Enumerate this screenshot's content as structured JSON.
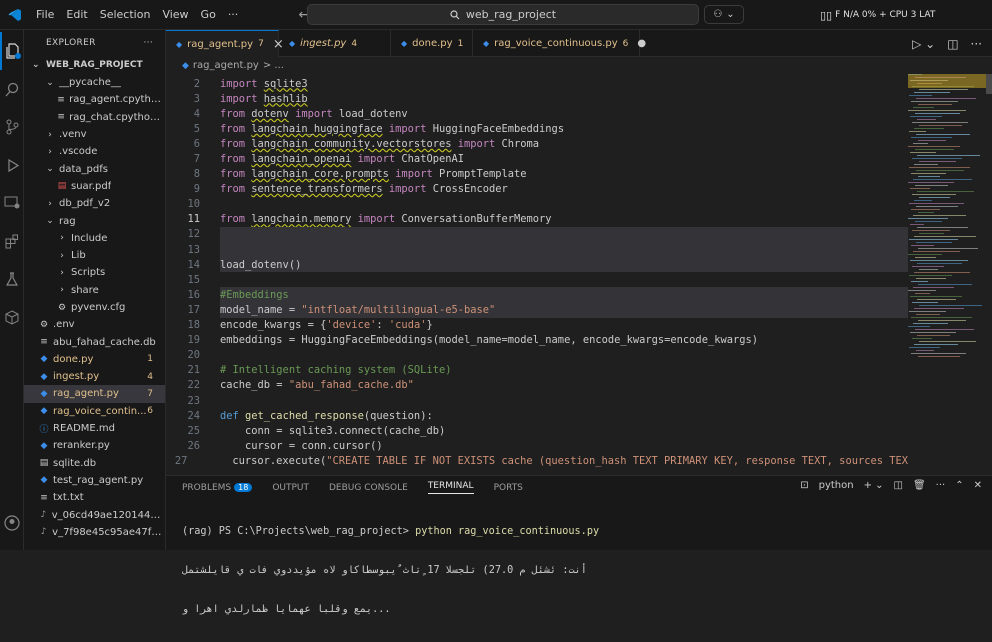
{
  "titlebar": {
    "menu": [
      "File",
      "Edit",
      "Selection",
      "View",
      "Go",
      "···"
    ],
    "search_text": "web_rag_project",
    "status_text": "F N/A 0% + CPU 3 LAT"
  },
  "sidebar": {
    "header": "EXPLORER",
    "more": "···",
    "root": "WEB_RAG_PROJECT",
    "items": [
      {
        "label": "__pycache__",
        "kind": "folder-open",
        "indent": 1,
        "color": "#cccccc"
      },
      {
        "label": "rag_agent.cpython-3...",
        "kind": "file-generic",
        "indent": 2,
        "color": "#cccccc"
      },
      {
        "label": "rag_chat.cpython-31...",
        "kind": "file-generic",
        "indent": 2,
        "color": "#cccccc"
      },
      {
        "label": ".venv",
        "kind": "folder",
        "indent": 1,
        "color": "#cccccc"
      },
      {
        "label": ".vscode",
        "kind": "folder",
        "indent": 1,
        "color": "#cccccc"
      },
      {
        "label": "data_pdfs",
        "kind": "folder-open",
        "indent": 1,
        "color": "#cccccc"
      },
      {
        "label": "suar.pdf",
        "kind": "file-pdf",
        "indent": 2,
        "color": "#cccccc"
      },
      {
        "label": "db_pdf_v2",
        "kind": "folder",
        "indent": 1,
        "color": "#cccccc"
      },
      {
        "label": "rag",
        "kind": "folder-open",
        "indent": 1,
        "color": "#cccccc"
      },
      {
        "label": "Include",
        "kind": "folder",
        "indent": 2,
        "color": "#cccccc"
      },
      {
        "label": "Lib",
        "kind": "folder",
        "indent": 2,
        "color": "#cccccc"
      },
      {
        "label": "Scripts",
        "kind": "folder",
        "indent": 2,
        "color": "#cccccc"
      },
      {
        "label": "share",
        "kind": "folder",
        "indent": 2,
        "color": "#cccccc"
      },
      {
        "label": "pyvenv.cfg",
        "kind": "file-gear",
        "indent": 2,
        "color": "#cccccc"
      },
      {
        "label": ".env",
        "kind": "file-gear",
        "indent": 0,
        "color": "#cccccc"
      },
      {
        "label": "abu_fahad_cache.db",
        "kind": "file-generic",
        "indent": 0,
        "color": "#cccccc"
      },
      {
        "label": "done.py",
        "kind": "file-python",
        "indent": 0,
        "color": "#e2c08d",
        "badge": "1"
      },
      {
        "label": "ingest.py",
        "kind": "file-python",
        "indent": 0,
        "color": "#e2c08d",
        "badge": "4"
      },
      {
        "label": "rag_agent.py",
        "kind": "file-python",
        "indent": 0,
        "color": "#e2c08d",
        "badge": "7",
        "selected": true
      },
      {
        "label": "rag_voice_contin...",
        "kind": "file-python",
        "indent": 0,
        "color": "#e2c08d",
        "badge": "6"
      },
      {
        "label": "README.md",
        "kind": "file-info",
        "indent": 0,
        "color": "#cccccc"
      },
      {
        "label": "reranker.py",
        "kind": "file-python",
        "indent": 0,
        "color": "#cccccc"
      },
      {
        "label": "sqlite.db",
        "kind": "file-db",
        "indent": 0,
        "color": "#cccccc"
      },
      {
        "label": "test_rag_agent.py",
        "kind": "file-python",
        "indent": 0,
        "color": "#cccccc"
      },
      {
        "label": "txt.txt",
        "kind": "file-text",
        "indent": 0,
        "color": "#cccccc"
      },
      {
        "label": "v_06cd49ae1201442aa...",
        "kind": "file-audio",
        "indent": 0,
        "color": "#cccccc"
      },
      {
        "label": "v_7f98e45c95ae47fbb...",
        "kind": "file-audio",
        "indent": 0,
        "color": "#cccccc"
      }
    ]
  },
  "tabs": [
    {
      "label": "rag_agent.py",
      "num": "7",
      "active": true,
      "close": "×",
      "italic": false
    },
    {
      "label": "ingest.py",
      "num": "4",
      "active": false,
      "close": "",
      "italic": true
    },
    {
      "label": "done.py",
      "num": "1",
      "active": false,
      "close": "",
      "italic": false
    },
    {
      "label": "rag_voice_continuous.py",
      "num": "6",
      "active": false,
      "close": "●",
      "italic": false
    }
  ],
  "breadcrumb": {
    "file": "rag_agent.py",
    "rest": "> ..."
  },
  "code_lines": [
    {
      "n": "2",
      "t": [
        [
          "kwc",
          "import "
        ],
        [
          "mod",
          "sqlite3"
        ]
      ]
    },
    {
      "n": "3",
      "t": [
        [
          "kwc",
          "import "
        ],
        [
          "mod",
          "hashlib"
        ]
      ]
    },
    {
      "n": "4",
      "t": [
        [
          "kwc",
          "from "
        ],
        [
          "mod",
          "dotenv"
        ],
        [
          "kwc",
          " import "
        ],
        [
          "op",
          "load_dotenv"
        ]
      ]
    },
    {
      "n": "5",
      "t": [
        [
          "kwc",
          "from "
        ],
        [
          "mod",
          "langchain_huggingface"
        ],
        [
          "kwc",
          " import "
        ],
        [
          "op",
          "HuggingFaceEmbeddings"
        ]
      ]
    },
    {
      "n": "6",
      "t": [
        [
          "kwc",
          "from "
        ],
        [
          "mod",
          "langchain_community.vectorstores"
        ],
        [
          "kwc",
          " import "
        ],
        [
          "op",
          "Chroma"
        ]
      ]
    },
    {
      "n": "7",
      "t": [
        [
          "kwc",
          "from "
        ],
        [
          "mod",
          "langchain_openai"
        ],
        [
          "kwc",
          " import "
        ],
        [
          "op",
          "ChatOpenAI"
        ]
      ]
    },
    {
      "n": "8",
      "t": [
        [
          "kwc",
          "from "
        ],
        [
          "mod",
          "langchain_core.prompts"
        ],
        [
          "kwc",
          " import "
        ],
        [
          "op",
          "PromptTemplate"
        ]
      ]
    },
    {
      "n": "9",
      "t": [
        [
          "kwc",
          "from "
        ],
        [
          "mod",
          "sentence_transformers"
        ],
        [
          "kwc",
          " import "
        ],
        [
          "op",
          "CrossEncoder"
        ]
      ]
    },
    {
      "n": "10",
      "t": []
    },
    {
      "n": "11",
      "t": [
        [
          "kwc",
          "from "
        ],
        [
          "mod",
          "langchain.memory"
        ],
        [
          "kwc",
          " import "
        ],
        [
          "op",
          "ConversationBufferMemory"
        ]
      ],
      "cur": true
    },
    {
      "n": "12",
      "t": [],
      "hl": true
    },
    {
      "n": "13",
      "t": [],
      "hl": true
    },
    {
      "n": "14",
      "t": [
        [
          "op",
          "load_dotenv()"
        ]
      ],
      "hl": true
    },
    {
      "n": "15",
      "t": []
    },
    {
      "n": "16",
      "t": [
        [
          "cmt",
          "#Embeddings"
        ]
      ],
      "hl": true
    },
    {
      "n": "17",
      "t": [
        [
          "op",
          "model_name = "
        ],
        [
          "str",
          "\"intfloat/multilingual-e5-base\""
        ]
      ],
      "hl": true
    },
    {
      "n": "18",
      "t": [
        [
          "op",
          "encode_kwargs = {"
        ],
        [
          "str",
          "'device'"
        ],
        [
          "op",
          ": "
        ],
        [
          "str",
          "'cuda'"
        ],
        [
          "op",
          "}"
        ]
      ]
    },
    {
      "n": "19",
      "t": [
        [
          "op",
          "embeddings = HuggingFaceEmbeddings(model_name=model_name, encode_kwargs=encode_kwargs)"
        ]
      ]
    },
    {
      "n": "20",
      "t": []
    },
    {
      "n": "21",
      "t": [
        [
          "cmt",
          "# Intelligent caching system (SQLite)"
        ]
      ]
    },
    {
      "n": "22",
      "t": [
        [
          "op",
          "cache_db = "
        ],
        [
          "str",
          "\"abu_fahad_cache.db\""
        ]
      ]
    },
    {
      "n": "23",
      "t": []
    },
    {
      "n": "24",
      "t": [
        [
          "kw",
          "def "
        ],
        [
          "fn",
          "get_cached_response"
        ],
        [
          "op",
          "(question):"
        ]
      ]
    },
    {
      "n": "25",
      "t": [
        [
          "op",
          "    conn = sqlite3.connect(cache_db)"
        ]
      ]
    },
    {
      "n": "26",
      "t": [
        [
          "op",
          "    cursor = conn.cursor()"
        ]
      ]
    },
    {
      "n": "27",
      "t": [
        [
          "op",
          "    cursor.execute("
        ],
        [
          "str",
          "\"CREATE TABLE IF NOT EXISTS cache (question_hash TEXT PRIMARY KEY, response TEXT, sources TEX"
        ]
      ]
    }
  ],
  "panel": {
    "tabs": [
      "PROBLEMS",
      "OUTPUT",
      "DEBUG CONSOLE",
      "TERMINAL",
      "PORTS"
    ],
    "problems_count": "18",
    "shell": "python",
    "terminal_lines": [
      "(rag) PS C:\\Projects\\web_rag_project> ",
      "أنت: ئشئل م 27.0) تلجسلا 17 ٍتاث ٌيبوسطاكاو لاه مؤيددوي فات ي قايلشتمل",
      "...يمع وقلبا عهمايا ظمارلدي اهرا و"
    ],
    "command": "python rag_voice_continuous.py"
  },
  "colors": {
    "accent": "#0078d4",
    "modified": "#e2c08d"
  }
}
